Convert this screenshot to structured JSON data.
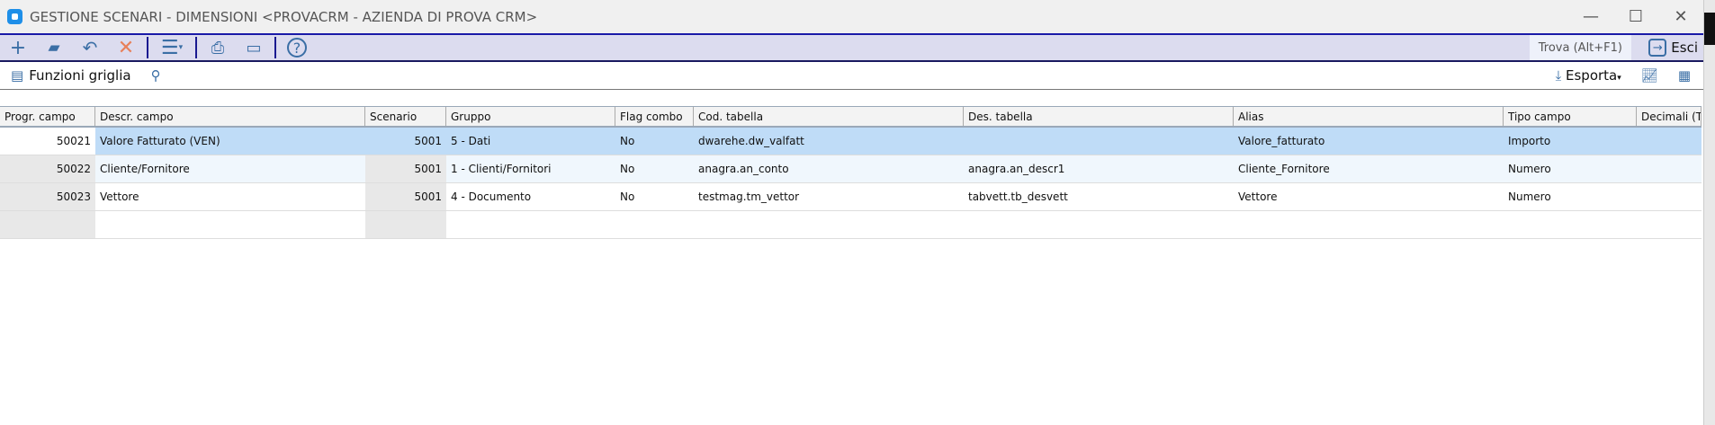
{
  "window": {
    "title": "GESTIONE SCENARI - DIMENSIONI <PROVACRM - AZIENDA DI PROVA CRM>",
    "minimize": "—",
    "maximize": "☐",
    "close": "✕"
  },
  "toolbar": {
    "find_label": "Trova (Alt+F1)",
    "exit_label": "Esci",
    "icons": [
      "plus-icon",
      "folder-icon",
      "undo-icon",
      "delete-icon",
      "menu-icon",
      "print-icon",
      "monitor-icon",
      "help-icon"
    ]
  },
  "gridbar": {
    "functions_label": "Funzioni griglia",
    "export_label": "Esporta"
  },
  "grid": {
    "columns": [
      "Progr. campo",
      "Descr. campo",
      "Scenario",
      "Gruppo",
      "Flag combo",
      "Cod. tabella",
      "Des. tabella",
      "Alias",
      "Tipo campo",
      "Decimali (T"
    ],
    "rows": [
      [
        "50021",
        "Valore Fatturato (VEN)",
        "5001",
        "5 - Dati",
        "No",
        "dwarehe.dw_valfatt",
        "",
        "Valore_fatturato",
        "Importo",
        ""
      ],
      [
        "50022",
        "Cliente/Fornitore",
        "5001",
        "1 - Clienti/Fornitori",
        "No",
        "anagra.an_conto",
        "anagra.an_descr1",
        "Cliente_Fornitore",
        "Numero",
        ""
      ],
      [
        "50023",
        "Vettore",
        "5001",
        "4 - Documento",
        "No",
        "testmag.tm_vettor",
        "tabvett.tb_desvett",
        "Vettore",
        "Numero",
        ""
      ]
    ]
  },
  "colors": {
    "accent": "#1a1aa8",
    "selected_row": "#bfdcf7",
    "toolbar_bg": "#dcdcef"
  }
}
